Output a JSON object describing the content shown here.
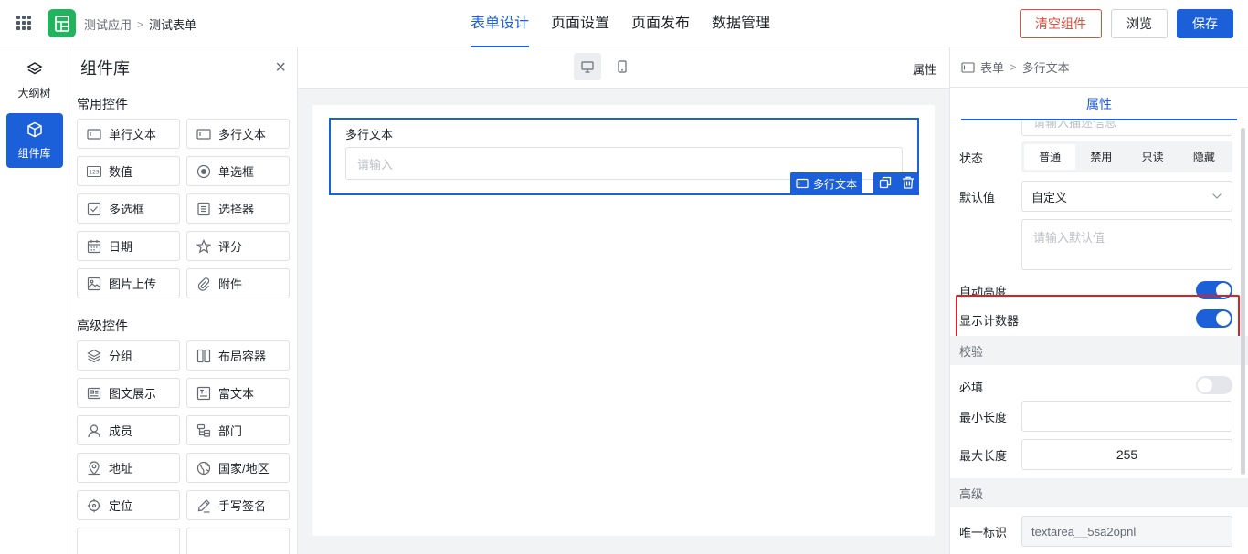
{
  "header": {
    "breadcrumb": [
      "测试应用",
      "测试表单"
    ],
    "breadcrumb_sep": ">",
    "tabs": [
      {
        "label": "表单设计",
        "active": true
      },
      {
        "label": "页面设置"
      },
      {
        "label": "页面发布"
      },
      {
        "label": "数据管理"
      }
    ],
    "clear_button": "清空组件",
    "preview_button": "浏览",
    "save_button": "保存"
  },
  "rail": {
    "items": [
      {
        "label": "大纲树",
        "icon": "layers-icon"
      },
      {
        "label": "组件库",
        "icon": "cube-icon",
        "active": true
      }
    ]
  },
  "library": {
    "title": "组件库",
    "close": "×",
    "groups": [
      {
        "title": "常用控件",
        "items": [
          {
            "label": "单行文本",
            "icon": "single-line-text-icon"
          },
          {
            "label": "多行文本",
            "icon": "multi-line-text-icon"
          },
          {
            "label": "数值",
            "icon": "number-icon",
            "glyph": "123"
          },
          {
            "label": "单选框",
            "icon": "radio-icon"
          },
          {
            "label": "多选框",
            "icon": "checkbox-icon"
          },
          {
            "label": "选择器",
            "icon": "select-icon"
          },
          {
            "label": "日期",
            "icon": "calendar-icon"
          },
          {
            "label": "评分",
            "icon": "star-icon"
          },
          {
            "label": "图片上传",
            "icon": "image-icon"
          },
          {
            "label": "附件",
            "icon": "paperclip-icon"
          }
        ]
      },
      {
        "title": "高级控件",
        "items": [
          {
            "label": "分组",
            "icon": "layers-icon"
          },
          {
            "label": "布局容器",
            "icon": "columns-icon"
          },
          {
            "label": "图文展示",
            "icon": "card-icon"
          },
          {
            "label": "富文本",
            "icon": "rich-text-icon"
          },
          {
            "label": "成员",
            "icon": "user-icon"
          },
          {
            "label": "部门",
            "icon": "org-tree-icon"
          },
          {
            "label": "地址",
            "icon": "map-pin-icon"
          },
          {
            "label": "国家/地区",
            "icon": "globe-icon"
          },
          {
            "label": "定位",
            "icon": "locate-icon"
          },
          {
            "label": "手写签名",
            "icon": "pen-icon"
          }
        ]
      }
    ]
  },
  "canvas": {
    "property_label": "属性",
    "field": {
      "label": "多行文本",
      "placeholder": "请输入",
      "tag": "多行文本"
    }
  },
  "panel": {
    "breadcrumb": [
      "表单",
      "多行文本"
    ],
    "tab": "属性",
    "desc_placeholder": "请输入描述信息",
    "status_label": "状态",
    "status_options": [
      "普通",
      "禁用",
      "只读",
      "隐藏"
    ],
    "status_selected": "普通",
    "default_label": "默认值",
    "default_select": "自定义",
    "default_placeholder": "请输入默认值",
    "auto_height_label": "自动高度",
    "auto_height_on": true,
    "show_counter_label": "显示计数器",
    "show_counter_on": true,
    "validation_section": "校验",
    "required_label": "必填",
    "required_on": false,
    "min_length_label": "最小长度",
    "min_length_value": "",
    "max_length_label": "最大长度",
    "max_length_value": "255",
    "advanced_section": "高级",
    "unique_id_label": "唯一标识",
    "unique_id_value": "textarea__5sa2opnl"
  },
  "colors": {
    "primary": "#1b5fd9",
    "danger": "#e34d3c",
    "logo": "#22b35e",
    "highlight": "#e02020"
  }
}
